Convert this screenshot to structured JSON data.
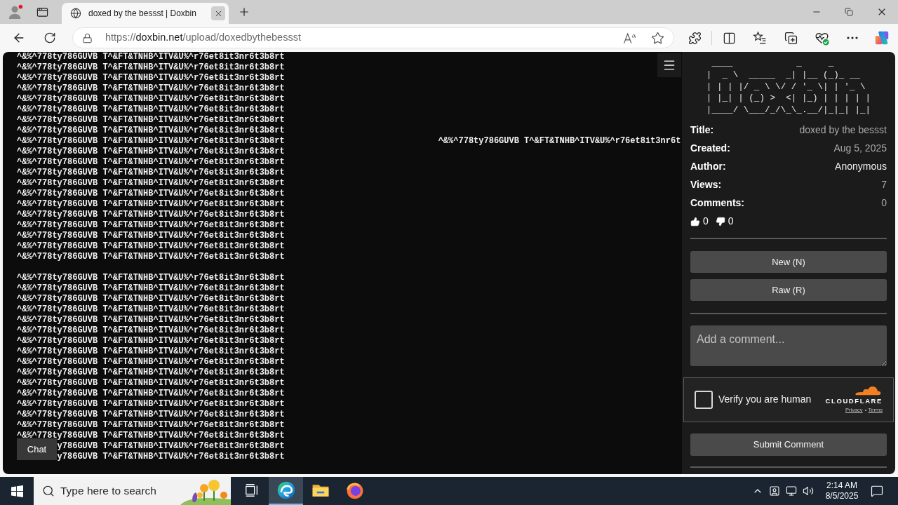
{
  "browser": {
    "tab": {
      "title": "doxed by the bessst | Doxbin"
    },
    "address": {
      "scheme": "https://",
      "host": "doxbin.net",
      "path": "/upload/doxedbythebessst"
    }
  },
  "paste": {
    "lines": [
      {
        "kind": "text",
        "text": "^&%^778ty786GUVB T^&FT&TNHB^ITV&U%^r76et8it3nr6t3b8rt"
      },
      {
        "kind": "text",
        "text": "^&%^778ty786GUVB T^&FT&TNHB^ITV&U%^r76et8it3nr6t3b8rt"
      },
      {
        "kind": "text",
        "text": "^&%^778ty786GUVB T^&FT&TNHB^ITV&U%^r76et8it3nr6t3b8rt"
      },
      {
        "kind": "text",
        "text": "^&%^778ty786GUVB T^&FT&TNHB^ITV&U%^r76et8it3nr6t3b8rt"
      },
      {
        "kind": "text",
        "text": "^&%^778ty786GUVB T^&FT&TNHB^ITV&U%^r76et8it3nr6t3b8rt"
      },
      {
        "kind": "text",
        "text": "^&%^778ty786GUVB T^&FT&TNHB^ITV&U%^r76et8it3nr6t3b8rt"
      },
      {
        "kind": "text",
        "text": "^&%^778ty786GUVB T^&FT&TNHB^ITV&U%^r76et8it3nr6t3b8rt"
      },
      {
        "kind": "text",
        "text": "^&%^778ty786GUVB T^&FT&TNHB^ITV&U%^r76et8it3nr6t3b8rt"
      },
      {
        "kind": "text",
        "text": "^&%^778ty786GUVB T^&FT&TNHB^ITV&U%^r76et8it3nr6t3b8rt",
        "extra": "^&%^778ty786GUVB T^&FT&TNHB^ITV&U%^r76et8it3nr6t"
      },
      {
        "kind": "text",
        "text": "^&%^778ty786GUVB T^&FT&TNHB^ITV&U%^r76et8it3nr6t3b8rt"
      },
      {
        "kind": "text",
        "text": "^&%^778ty786GUVB T^&FT&TNHB^ITV&U%^r76et8it3nr6t3b8rt"
      },
      {
        "kind": "text",
        "text": "^&%^778ty786GUVB T^&FT&TNHB^ITV&U%^r76et8it3nr6t3b8rt"
      },
      {
        "kind": "text",
        "text": "^&%^778ty786GUVB T^&FT&TNHB^ITV&U%^r76et8it3nr6t3b8rt"
      },
      {
        "kind": "text",
        "text": "^&%^778ty786GUVB T^&FT&TNHB^ITV&U%^r76et8it3nr6t3b8rt"
      },
      {
        "kind": "text",
        "text": "^&%^778ty786GUVB T^&FT&TNHB^ITV&U%^r76et8it3nr6t3b8rt"
      },
      {
        "kind": "text",
        "text": "^&%^778ty786GUVB T^&FT&TNHB^ITV&U%^r76et8it3nr6t3b8rt"
      },
      {
        "kind": "text",
        "text": "^&%^778ty786GUVB T^&FT&TNHB^ITV&U%^r76et8it3nr6t3b8rt"
      },
      {
        "kind": "text",
        "text": "^&%^778ty786GUVB T^&FT&TNHB^ITV&U%^r76et8it3nr6t3b8rt"
      },
      {
        "kind": "text",
        "text": "^&%^778ty786GUVB T^&FT&TNHB^ITV&U%^r76et8it3nr6t3b8rt"
      },
      {
        "kind": "text",
        "text": "^&%^778ty786GUVB T^&FT&TNHB^ITV&U%^r76et8it3nr6t3b8rt"
      },
      {
        "kind": "blank"
      },
      {
        "kind": "text",
        "text": "^&%^778ty786GUVB T^&FT&TNHB^ITV&U%^r76et8it3nr6t3b8rt"
      },
      {
        "kind": "text",
        "text": "^&%^778ty786GUVB T^&FT&TNHB^ITV&U%^r76et8it3nr6t3b8rt"
      },
      {
        "kind": "text",
        "text": "^&%^778ty786GUVB T^&FT&TNHB^ITV&U%^r76et8it3nr6t3b8rt"
      },
      {
        "kind": "text",
        "text": "^&%^778ty786GUVB T^&FT&TNHB^ITV&U%^r76et8it3nr6t3b8rt"
      },
      {
        "kind": "text",
        "text": "^&%^778ty786GUVB T^&FT&TNHB^ITV&U%^r76et8it3nr6t3b8rt"
      },
      {
        "kind": "text",
        "text": "^&%^778ty786GUVB T^&FT&TNHB^ITV&U%^r76et8it3nr6t3b8rt"
      },
      {
        "kind": "text",
        "text": "^&%^778ty786GUVB T^&FT&TNHB^ITV&U%^r76et8it3nr6t3b8rt"
      },
      {
        "kind": "text",
        "text": "^&%^778ty786GUVB T^&FT&TNHB^ITV&U%^r76et8it3nr6t3b8rt"
      },
      {
        "kind": "text",
        "text": "^&%^778ty786GUVB T^&FT&TNHB^ITV&U%^r76et8it3nr6t3b8rt"
      },
      {
        "kind": "text",
        "text": "^&%^778ty786GUVB T^&FT&TNHB^ITV&U%^r76et8it3nr6t3b8rt"
      },
      {
        "kind": "text",
        "text": "^&%^778ty786GUVB T^&FT&TNHB^ITV&U%^r76et8it3nr6t3b8rt"
      },
      {
        "kind": "text",
        "text": "^&%^778ty786GUVB T^&FT&TNHB^ITV&U%^r76et8it3nr6t3b8rt"
      },
      {
        "kind": "text",
        "text": "^&%^778ty786GUVB T^&FT&TNHB^ITV&U%^r76et8it3nr6t3b8rt"
      },
      {
        "kind": "text",
        "text": "^&%^778ty786GUVB T^&FT&TNHB^ITV&U%^r76et8it3nr6t3b8rt"
      },
      {
        "kind": "text",
        "text": "^&%^778ty786GUVB T^&FT&TNHB^ITV&U%^r76et8it3nr6t3b8rt"
      },
      {
        "kind": "text",
        "text": "^&%^778ty786GUVB T^&FT&TNHB^ITV&U%^r76et8it3nr6t3b8rt"
      },
      {
        "kind": "covered",
        "text": "y786GUVB T^&FT&TNHB^ITV&U%^r76et8it3nr6t3b8rt"
      },
      {
        "kind": "covered",
        "text": "y786GUVB T^&FT&TNHB^ITV&U%^r76et8it3nr6t3b8rt"
      }
    ],
    "chat_button": "Chat"
  },
  "sidebar": {
    "logo_art": [
      " ____            _     _",
      "|  _ \\  _____  _| |__ (_)_ __",
      "| | | |/ _ \\ \\/ / '_ \\| | '_ \\",
      "| |_| | (_) >  <| |_) | | | | |",
      "|____/ \\___/_/\\_\\_.__/|_|_| |_|"
    ],
    "info": [
      {
        "label": "Title:",
        "value": "doxed by the bessst",
        "kind": "plain"
      },
      {
        "label": "Created:",
        "value": "Aug 5, 2025",
        "kind": "plain"
      },
      {
        "label": "Author:",
        "value": "Anonymous",
        "kind": "user"
      },
      {
        "label": "Views:",
        "value": "7",
        "kind": "plain"
      },
      {
        "label": "Comments:",
        "value": "0",
        "kind": "plain"
      }
    ],
    "votes": [
      {
        "kind": "up",
        "count": "0"
      },
      {
        "kind": "down",
        "count": "0"
      }
    ],
    "buttons": [
      "New (N)",
      "Raw (R)"
    ],
    "comment": {
      "placeholder": "Add a comment..."
    },
    "captcha": {
      "label": "Verify you are human",
      "checked": false,
      "brand": "CLOUDFLARE",
      "links": [
        "Privacy",
        "Terms"
      ]
    },
    "submit": "Submit Comment"
  },
  "taskbar": {
    "search_placeholder": "Type here to search",
    "apps": [
      {
        "kind": "task-view",
        "selected": false
      },
      {
        "kind": "browser",
        "selected": true
      },
      {
        "kind": "folder",
        "selected": false
      },
      {
        "kind": "fox",
        "selected": false
      }
    ],
    "time": "2:14 AM",
    "date": "8/5/2025"
  }
}
